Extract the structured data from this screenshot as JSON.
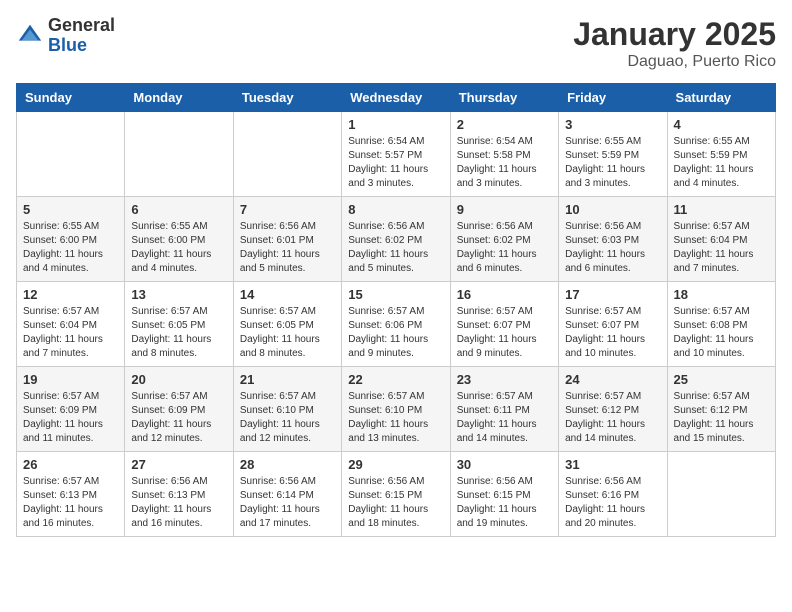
{
  "header": {
    "logo_general": "General",
    "logo_blue": "Blue",
    "month_title": "January 2025",
    "location": "Daguao, Puerto Rico"
  },
  "days_of_week": [
    "Sunday",
    "Monday",
    "Tuesday",
    "Wednesday",
    "Thursday",
    "Friday",
    "Saturday"
  ],
  "weeks": [
    [
      {
        "day": "",
        "info": ""
      },
      {
        "day": "",
        "info": ""
      },
      {
        "day": "",
        "info": ""
      },
      {
        "day": "1",
        "info": "Sunrise: 6:54 AM\nSunset: 5:57 PM\nDaylight: 11 hours\nand 3 minutes."
      },
      {
        "day": "2",
        "info": "Sunrise: 6:54 AM\nSunset: 5:58 PM\nDaylight: 11 hours\nand 3 minutes."
      },
      {
        "day": "3",
        "info": "Sunrise: 6:55 AM\nSunset: 5:59 PM\nDaylight: 11 hours\nand 3 minutes."
      },
      {
        "day": "4",
        "info": "Sunrise: 6:55 AM\nSunset: 5:59 PM\nDaylight: 11 hours\nand 4 minutes."
      }
    ],
    [
      {
        "day": "5",
        "info": "Sunrise: 6:55 AM\nSunset: 6:00 PM\nDaylight: 11 hours\nand 4 minutes."
      },
      {
        "day": "6",
        "info": "Sunrise: 6:55 AM\nSunset: 6:00 PM\nDaylight: 11 hours\nand 4 minutes."
      },
      {
        "day": "7",
        "info": "Sunrise: 6:56 AM\nSunset: 6:01 PM\nDaylight: 11 hours\nand 5 minutes."
      },
      {
        "day": "8",
        "info": "Sunrise: 6:56 AM\nSunset: 6:02 PM\nDaylight: 11 hours\nand 5 minutes."
      },
      {
        "day": "9",
        "info": "Sunrise: 6:56 AM\nSunset: 6:02 PM\nDaylight: 11 hours\nand 6 minutes."
      },
      {
        "day": "10",
        "info": "Sunrise: 6:56 AM\nSunset: 6:03 PM\nDaylight: 11 hours\nand 6 minutes."
      },
      {
        "day": "11",
        "info": "Sunrise: 6:57 AM\nSunset: 6:04 PM\nDaylight: 11 hours\nand 7 minutes."
      }
    ],
    [
      {
        "day": "12",
        "info": "Sunrise: 6:57 AM\nSunset: 6:04 PM\nDaylight: 11 hours\nand 7 minutes."
      },
      {
        "day": "13",
        "info": "Sunrise: 6:57 AM\nSunset: 6:05 PM\nDaylight: 11 hours\nand 8 minutes."
      },
      {
        "day": "14",
        "info": "Sunrise: 6:57 AM\nSunset: 6:05 PM\nDaylight: 11 hours\nand 8 minutes."
      },
      {
        "day": "15",
        "info": "Sunrise: 6:57 AM\nSunset: 6:06 PM\nDaylight: 11 hours\nand 9 minutes."
      },
      {
        "day": "16",
        "info": "Sunrise: 6:57 AM\nSunset: 6:07 PM\nDaylight: 11 hours\nand 9 minutes."
      },
      {
        "day": "17",
        "info": "Sunrise: 6:57 AM\nSunset: 6:07 PM\nDaylight: 11 hours\nand 10 minutes."
      },
      {
        "day": "18",
        "info": "Sunrise: 6:57 AM\nSunset: 6:08 PM\nDaylight: 11 hours\nand 10 minutes."
      }
    ],
    [
      {
        "day": "19",
        "info": "Sunrise: 6:57 AM\nSunset: 6:09 PM\nDaylight: 11 hours\nand 11 minutes."
      },
      {
        "day": "20",
        "info": "Sunrise: 6:57 AM\nSunset: 6:09 PM\nDaylight: 11 hours\nand 12 minutes."
      },
      {
        "day": "21",
        "info": "Sunrise: 6:57 AM\nSunset: 6:10 PM\nDaylight: 11 hours\nand 12 minutes."
      },
      {
        "day": "22",
        "info": "Sunrise: 6:57 AM\nSunset: 6:10 PM\nDaylight: 11 hours\nand 13 minutes."
      },
      {
        "day": "23",
        "info": "Sunrise: 6:57 AM\nSunset: 6:11 PM\nDaylight: 11 hours\nand 14 minutes."
      },
      {
        "day": "24",
        "info": "Sunrise: 6:57 AM\nSunset: 6:12 PM\nDaylight: 11 hours\nand 14 minutes."
      },
      {
        "day": "25",
        "info": "Sunrise: 6:57 AM\nSunset: 6:12 PM\nDaylight: 11 hours\nand 15 minutes."
      }
    ],
    [
      {
        "day": "26",
        "info": "Sunrise: 6:57 AM\nSunset: 6:13 PM\nDaylight: 11 hours\nand 16 minutes."
      },
      {
        "day": "27",
        "info": "Sunrise: 6:56 AM\nSunset: 6:13 PM\nDaylight: 11 hours\nand 16 minutes."
      },
      {
        "day": "28",
        "info": "Sunrise: 6:56 AM\nSunset: 6:14 PM\nDaylight: 11 hours\nand 17 minutes."
      },
      {
        "day": "29",
        "info": "Sunrise: 6:56 AM\nSunset: 6:15 PM\nDaylight: 11 hours\nand 18 minutes."
      },
      {
        "day": "30",
        "info": "Sunrise: 6:56 AM\nSunset: 6:15 PM\nDaylight: 11 hours\nand 19 minutes."
      },
      {
        "day": "31",
        "info": "Sunrise: 6:56 AM\nSunset: 6:16 PM\nDaylight: 11 hours\nand 20 minutes."
      },
      {
        "day": "",
        "info": ""
      }
    ]
  ]
}
